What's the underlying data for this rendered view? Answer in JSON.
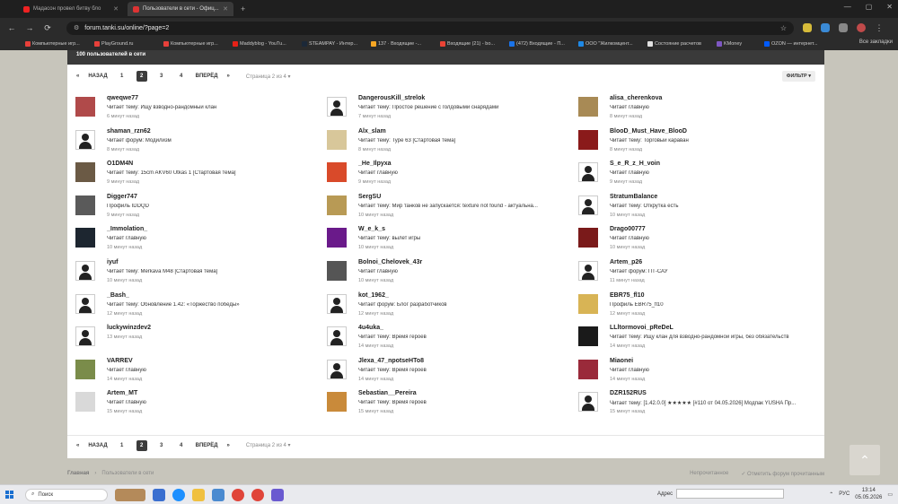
{
  "browser": {
    "tabs": [
      {
        "title": "Мадасон провел битву бло"
      },
      {
        "title": "Пользователи в сети - Офиц..."
      }
    ],
    "url": "forum.tanki.su/online/?page=2",
    "all_bookmarks": "Все закладки",
    "bookmarks": [
      {
        "label": "Компьютерные игр...",
        "color": "#e8403a"
      },
      {
        "label": "PlayGround.ru",
        "color": "#e8403a"
      },
      {
        "label": "Компьютерные игр...",
        "color": "#e8403a"
      },
      {
        "label": "Maddyblog - YouTu...",
        "color": "#e62117"
      },
      {
        "label": "STEAMPAY - Интер...",
        "color": "#1b2838"
      },
      {
        "label": "137 · Входящие -...",
        "color": "#f6a623"
      },
      {
        "label": "Входящие (21) - bo...",
        "color": "#ea4335"
      },
      {
        "label": "(472) Входящие - П...",
        "color": "#1a73e8"
      },
      {
        "label": "ООО \"Жилкомцент...",
        "color": "#1e88e5"
      },
      {
        "label": "Состояние расчетов",
        "color": "#e0e0e0"
      },
      {
        "label": "KMoney",
        "color": "#7e57c2"
      },
      {
        "label": "OZON — интернет...",
        "color": "#005bff"
      }
    ]
  },
  "panel": {
    "header": "100 пользователей в сети",
    "filter_label": "ФИЛЬТР ▾"
  },
  "pagination": {
    "first": "«",
    "prev": "НАЗАД",
    "pages": [
      "1",
      "2",
      "3",
      "4"
    ],
    "current": "2",
    "next": "ВПЕРЁД",
    "last": "»",
    "page_of": "Страница 2 из 4 ▾"
  },
  "users": [
    {
      "name": "qweqwe77",
      "activity": "Читает тему: Ищу взводно-рандомный клан",
      "time": "6 минут назад",
      "avatar": "#b04a4a"
    },
    {
      "name": "shaman_rzn62",
      "activity": "Читает форум: Модилизм",
      "time": "8 минут назад",
      "avatar": "default"
    },
    {
      "name": "O1DM4N",
      "activity": "Читает тему: 15cm AKV60 Utkas 1 [Стартовая тема]",
      "time": "9 минут назад",
      "avatar": "#6b5a45"
    },
    {
      "name": "Digger747",
      "activity": "Профиль IDDQD",
      "time": "9 минут назад",
      "avatar": "#5a5a5a"
    },
    {
      "name": "_Immolation_",
      "activity": "Читает главную",
      "time": "10 минут назад",
      "avatar": "#1d2630"
    },
    {
      "name": "iyuf",
      "activity": "Читает тему: Merkava M48 [Стартовая тема]",
      "time": "10 минут назад",
      "avatar": "default"
    },
    {
      "name": "_Bash_",
      "activity": "Читает тему: Обновление 1.42: «Торжество победы»",
      "time": "12 минут назад",
      "avatar": "default"
    },
    {
      "name": "luckywinzdev2",
      "activity": "",
      "time": "13 минут назад",
      "avatar": "default"
    },
    {
      "name": "VARREV",
      "activity": "Читает главную",
      "time": "14 минут назад",
      "avatar": "#7a8c4a"
    },
    {
      "name": "Artem_MT",
      "activity": "Читает главную",
      "time": "15 минут назад",
      "avatar": "#d9d9d9"
    },
    {
      "name": "DangerousKill_strelok",
      "activity": "Читает тему: Простое решение с голдовыми снарядами",
      "time": "7 минут назад",
      "avatar": "default"
    },
    {
      "name": "Alx_slam",
      "activity": "Читает тему: Type 63 [Стартовая тема]",
      "time": "8 минут назад",
      "avatar": "#d8c79a"
    },
    {
      "name": "_He_Ilpyxa",
      "activity": "Читает главную",
      "time": "9 минут назад",
      "avatar": "#d94a2a"
    },
    {
      "name": "SergSU",
      "activity": "Читает тему: Мир танков не запускается: texture not found - актуальна...",
      "time": "10 минут назад",
      "avatar": "#b89a55"
    },
    {
      "name": "W_e_k_s",
      "activity": "Читает тему: вылет игры",
      "time": "10 минут назад",
      "avatar": "#6a1a8a"
    },
    {
      "name": "Bolnoi_Chelovek_43r",
      "activity": "Читает главную",
      "time": "10 минут назад",
      "avatar": "#555555"
    },
    {
      "name": "kot_1962_",
      "activity": "Читает форум: Блог разработчиков",
      "time": "12 минут назад",
      "avatar": "default"
    },
    {
      "name": "4u4uka_",
      "activity": "Читает тему: Время героев",
      "time": "14 минут назад",
      "avatar": "default"
    },
    {
      "name": "Jlexa_47_npotseHTo8",
      "activity": "Читает тему: Время героев",
      "time": "14 минут назад",
      "avatar": "default"
    },
    {
      "name": "Sebastian__Pereira",
      "activity": "Читает тему: Время героев",
      "time": "15 минут назад",
      "avatar": "#c98a3a"
    },
    {
      "name": "alisa_cherenkova",
      "activity": "Читает главную",
      "time": "8 минут назад",
      "avatar": "#a88a55"
    },
    {
      "name": "BlooD_Must_Have_BlooD",
      "activity": "Читает тему: Торговый караван",
      "time": "8 минут назад",
      "avatar": "#8a1a1a"
    },
    {
      "name": "S_e_R_z_H_voin",
      "activity": "Читает главную",
      "time": "9 минут назад",
      "avatar": "default"
    },
    {
      "name": "StratumBalance",
      "activity": "Читает тему: Открутка есть",
      "time": "10 минут назад",
      "avatar": "default"
    },
    {
      "name": "Drago00777",
      "activity": "Читает главную",
      "time": "10 минут назад",
      "avatar": "#7a1a1a"
    },
    {
      "name": "Artem_p26",
      "activity": "Читает форум: ПТ-САУ",
      "time": "11 минут назад",
      "avatar": "default"
    },
    {
      "name": "EBR75_fl10",
      "activity": "Профиль EBR75_fl10",
      "time": "12 минут назад",
      "avatar": "#d8b455"
    },
    {
      "name": "LLltormovoi_pReDeL",
      "activity": "Читает тему: Ищу клан для взводно-рандомной игры, без обязательств",
      "time": "14 минут назад",
      "avatar": "#1a1a1a"
    },
    {
      "name": "Miaonei",
      "activity": "Читает главную",
      "time": "14 минут назад",
      "avatar": "#9a2a3a"
    },
    {
      "name": "DZR152RUS",
      "activity": "Читает тему: [1.42.0.0] ★★★★★ [#110 от 04.05.2026] Модпак YUSHA Пр...",
      "time": "15 минут назад",
      "avatar": "default"
    }
  ],
  "breadcrumbs": {
    "home": "Главная",
    "sep": "›",
    "current": "Пользователи в сети",
    "unread": "Непрочитанное",
    "mark_read": "✓ Отметить форум прочитанным"
  },
  "taskbar": {
    "search": "Поиск",
    "address_label": "Адрес",
    "lang": "РУС",
    "time": "13:14",
    "date": "05.05.2026"
  }
}
